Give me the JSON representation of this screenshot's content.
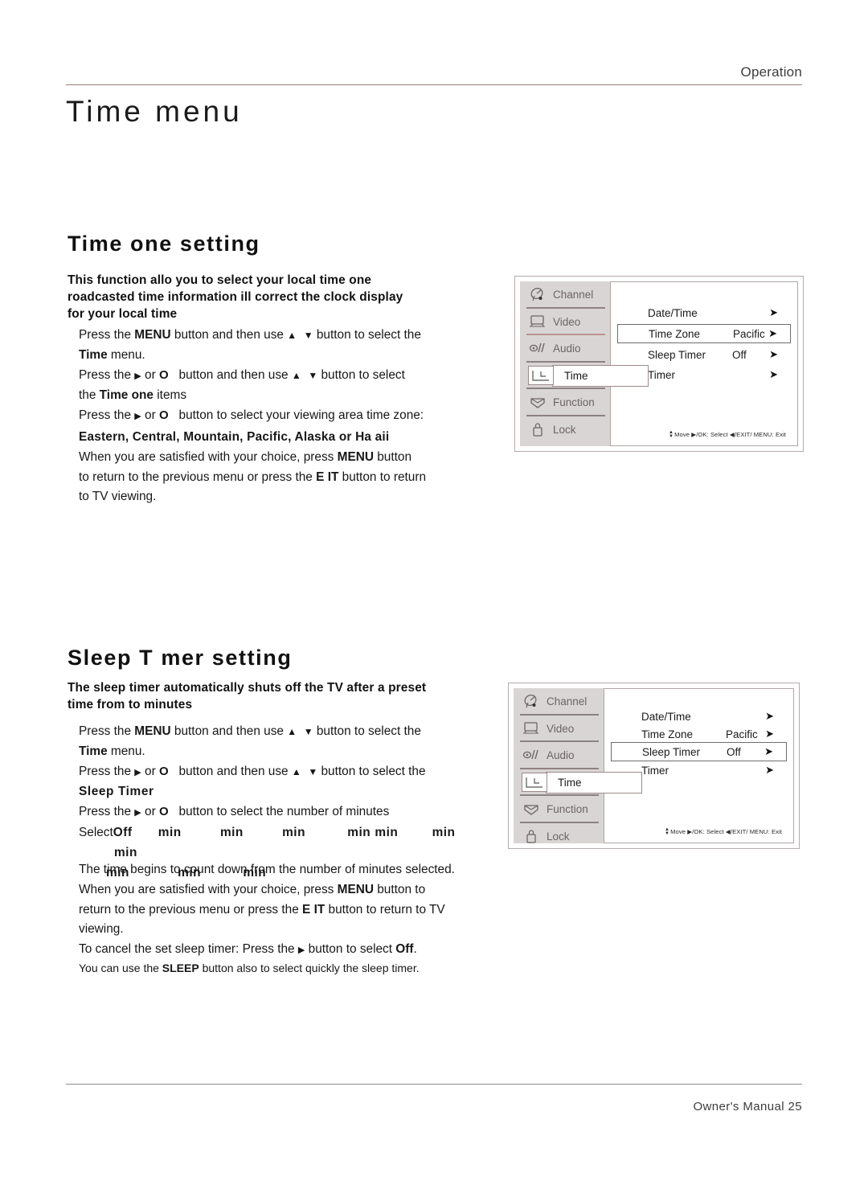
{
  "header": {
    "section_label": "Operation",
    "page_title": "Time  menu"
  },
  "footer": {
    "label": "Owner's Manual  25"
  },
  "sections": [
    {
      "id": "timezone",
      "heading": "Time  one setting",
      "intro": "This function allo  you to select  your local time  one  roadcasted time information  ill correct the clock display for your local  time",
      "intro_lines": [
        "This function allo you to select your local time one",
        " roadcasted time information ill correct the clock display",
        "for your local time"
      ]
    },
    {
      "id": "sleeptimer",
      "heading": "Sleep T mer setting",
      "intro_lines": [
        "The sleep timer automatically shuts off the TV after a preset",
        " time  from  to      minutes"
      ]
    }
  ],
  "timezone_body": {
    "line1_a": "Press the ",
    "line1_menu": "MENU",
    "line1_b": " button and then use ",
    "line1_c": " button to select the",
    "line2_time": "Time",
    "line2_rest": " menu.",
    "line3_a": "Press the ",
    "line3_ok": "O",
    "line3_b": " button and then use ",
    "line3_c": " button to select",
    "line4_a": "the ",
    "line4_b": "Time    one",
    "line4_c": " items",
    "line5_a": "Press the ",
    "line5_b": " button  to select your viewing area time zone:",
    "zones": "Eastern, Central, Mountain, Pacific, Alaska or Ha  aii",
    "line6": "When you are satisfied with your choice,  press ",
    "line6_menu": "MENU",
    "line6_b": " button",
    "line7": "to return to the previous menu or press the ",
    "line7_exit": "E   IT",
    "line7_b": " button to return",
    "line8": "to TV viewing."
  },
  "sleeptimer_body": {
    "line1_a": "Press the ",
    "line1_menu": "MENU",
    "line1_b": " button and then use ",
    "line1_c": " button to select the",
    "line2_time": "Time",
    "line2_rest": " menu.",
    "line3_a": "Press the ",
    "line3_ok": "O",
    "line3_b": " button and then use ",
    "line3_c": " button to select the",
    "line4_label": "Sleep Timer",
    "line5_a": "Press the ",
    "line5_ok": "O",
    "line5_b": " button  to select the number of minutes",
    "select_prefix": "Select ",
    "select_off": "Off",
    "minutes_row1": [
      "min",
      "min",
      "min",
      "min",
      "min",
      "min",
      "min"
    ],
    "minutes_row2": [
      "min",
      "min",
      "min"
    ],
    "p1": "The time begins to count down from the number of minutes selected.",
    "p2_a": "When you are satisfied with your choice,  press ",
    "p2_menu": "MENU",
    "p2_b": " button to",
    "p3_a": "return to the previous menu or press the ",
    "p3_exit": "E   IT",
    "p3_b": " button to return to TV",
    "p4": "viewing.",
    "p5_a": "To cancel the set sleep timer: Press the ",
    "p5_b": " button to select  ",
    "p5_off": "Off",
    "p5_c": "."
  },
  "note": {
    "a": "You can use the ",
    "sleep": "SLEEP",
    "b": " button also to select quickly the sleep timer."
  },
  "osd": {
    "sidebar": [
      {
        "label": "Channel",
        "icon": "satellite-dish-icon"
      },
      {
        "label": "Video",
        "icon": "monitor-icon"
      },
      {
        "label": "Audio",
        "icon": "speaker-note-icon"
      },
      {
        "label": "Time",
        "icon": "clock-icon"
      },
      {
        "label": "Function",
        "icon": "box-icon"
      },
      {
        "label": "Lock",
        "icon": "padlock-icon"
      }
    ],
    "active_index": 3,
    "items": [
      {
        "name": "Date/Time",
        "value": "",
        "arrow": "➤"
      },
      {
        "name": "Time Zone",
        "value": "Pacific",
        "arrow": "➤"
      },
      {
        "name": "Sleep Timer",
        "value": "Off",
        "arrow": "➤"
      },
      {
        "name": "Timer",
        "value": "",
        "arrow": "➤"
      }
    ],
    "hint": "Move  ▶/OK: Select  ◀/EXIT/ MENU: Exit",
    "selected_timezone_index": 1,
    "selected_sleeptimer_index": 2
  },
  "colors": {
    "rule_rose": "#9b7b7b",
    "sidebar_bg": "#d9d5d5",
    "label_grey": "#6e6464"
  }
}
